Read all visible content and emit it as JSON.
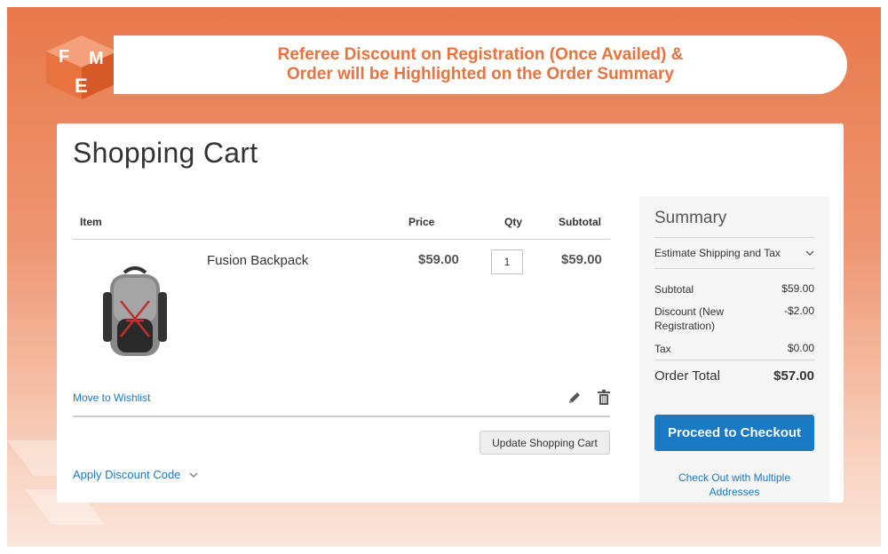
{
  "banner": {
    "line1": "Referee Discount on Registration (Once Availed) &",
    "line2": "Order will be Highlighted on the Order Summary"
  },
  "cart": {
    "title": "Shopping Cart",
    "headers": {
      "item": "Item",
      "price": "Price",
      "qty": "Qty",
      "subtotal": "Subtotal"
    },
    "items": [
      {
        "name": "Fusion Backpack",
        "price": "$59.00",
        "qty": "1",
        "subtotal": "$59.00"
      }
    ],
    "move_to_wishlist": "Move to Wishlist",
    "update_button": "Update Shopping Cart",
    "apply_discount": "Apply Discount Code"
  },
  "summary": {
    "title": "Summary",
    "estimate_shipping": "Estimate Shipping and Tax",
    "rows": [
      {
        "label": "Subtotal",
        "value": "$59.00"
      },
      {
        "label": "Discount (New Registration)",
        "value": "-$2.00"
      },
      {
        "label": "Tax",
        "value": "$0.00"
      }
    ],
    "order_total_label": "Order Total",
    "order_total_value": "$57.00",
    "checkout_button": "Proceed to Checkout",
    "multi_address_link": "Check Out with Multiple Addresses"
  },
  "colors": {
    "brand_orange": "#e8733f",
    "link_blue": "#1979c3",
    "checkout_blue": "#1979c3"
  },
  "icons": [
    "fme-logo",
    "edit-icon",
    "trash-icon",
    "chevron-down-icon"
  ]
}
